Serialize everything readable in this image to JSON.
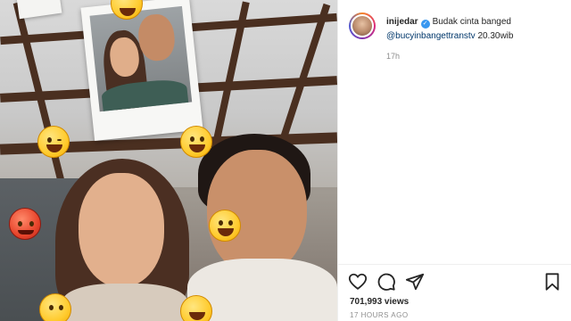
{
  "post": {
    "username": "inijedar",
    "caption_text": "Budak cinta banged",
    "mention": "@bucyinbangettranstv",
    "caption_tail": "20.30wib",
    "time_ago": "17h"
  },
  "engagement": {
    "views_text": "701,993 views",
    "posted_label": "17 HOURS AGO"
  },
  "icons": {
    "like": "heart-icon",
    "comment": "comment-icon",
    "share": "paper-plane-icon",
    "save": "bookmark-icon",
    "verified": "verified-badge-icon"
  },
  "colors": {
    "link": "#00376b",
    "verified": "#3897f0",
    "meta": "#8e8e8e",
    "text": "#262626"
  }
}
